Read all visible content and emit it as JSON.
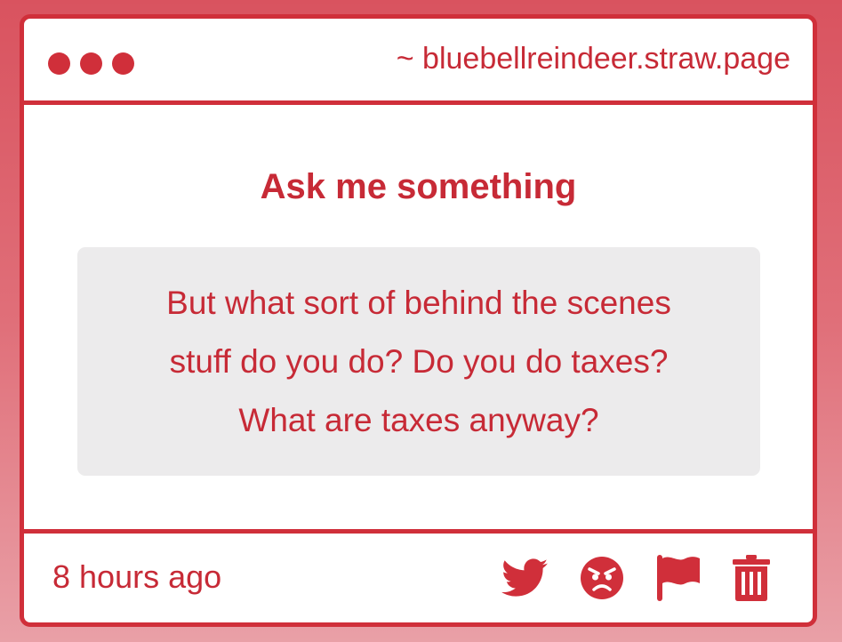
{
  "window": {
    "url": "~ bluebellreindeer.straw.page"
  },
  "main": {
    "heading": "Ask me something",
    "question_lines": [
      "But what sort of behind the scenes",
      "stuff do you do? Do you do taxes?",
      "What are taxes anyway?"
    ]
  },
  "footer": {
    "timestamp": "8 hours ago",
    "actions": [
      {
        "name": "twitter-share",
        "icon": "twitter-bird-icon"
      },
      {
        "name": "angry-react",
        "icon": "angry-face-icon"
      },
      {
        "name": "report",
        "icon": "flag-icon"
      },
      {
        "name": "delete",
        "icon": "trash-icon"
      }
    ]
  },
  "colors": {
    "accent": "#d02f3a",
    "text": "#c72a36",
    "question_background": "#ecebec",
    "card_background": "#ffffff"
  }
}
